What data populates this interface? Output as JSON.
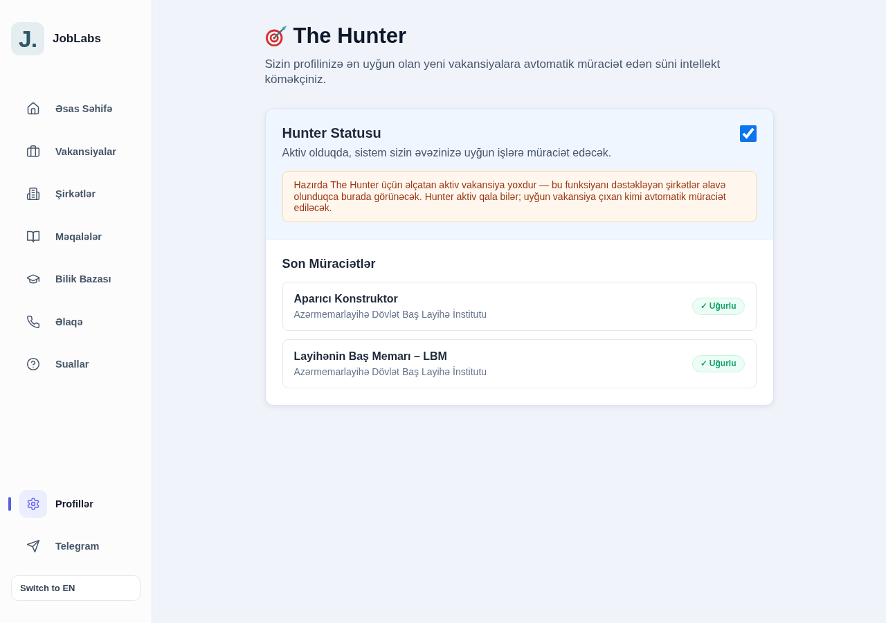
{
  "sidebar": {
    "logo": {
      "mark": "J.",
      "name": "JobLabs"
    },
    "nav_items": [
      {
        "label": "Əsas Səhifə",
        "selected": false
      },
      {
        "label": "Vakansiyalar",
        "selected": false
      },
      {
        "label": "Şirkətlər",
        "selected": false
      },
      {
        "label": "Məqalələr",
        "selected": false
      },
      {
        "label": "Bilik Bazası",
        "selected": false
      },
      {
        "label": "Əlaqə",
        "selected": false
      },
      {
        "label": "Suallar",
        "selected": false
      }
    ],
    "bottom_items": [
      {
        "label": "Profillər",
        "selected": true
      },
      {
        "label": "Telegram",
        "selected": false
      }
    ],
    "language_button": "Switch to EN"
  },
  "header": {
    "title": "The Hunter",
    "subtitle": "Sizin profilinizə ən uyğun olan yeni vakansiyalara avtomatik müraciət edən süni intellekt köməkçiniz."
  },
  "status": {
    "title": "Hunter Statusu",
    "description": "Aktiv olduqda, sistem sizin əvəzinizə uyğun işlərə müraciət edəcək.",
    "checked": true,
    "notice": "Hazırda The Hunter üçün əlçatan aktiv vakansiya yoxdur — bu funksiyanı dəstəkləyən şirkətlər əlavə olunduqca burada görünəcək. Hunter aktiv qala bilər; uyğun vakansiya çıxan kimi avtomatik müraciət ediləcək."
  },
  "recent": {
    "title": "Son Müraciətlər",
    "items": [
      {
        "position": "Aparıcı Konstruktor",
        "company": "Azərmemarlayihə Dövlət Baş Layihə İnstitutu",
        "status": "✓ Uğurlu"
      },
      {
        "position": "Layihənin Baş Memarı – LBM",
        "company": "Azərmemarlayihə Dövlət Baş Layihə İnstitutu",
        "status": "✓ Uğurlu"
      }
    ]
  }
}
